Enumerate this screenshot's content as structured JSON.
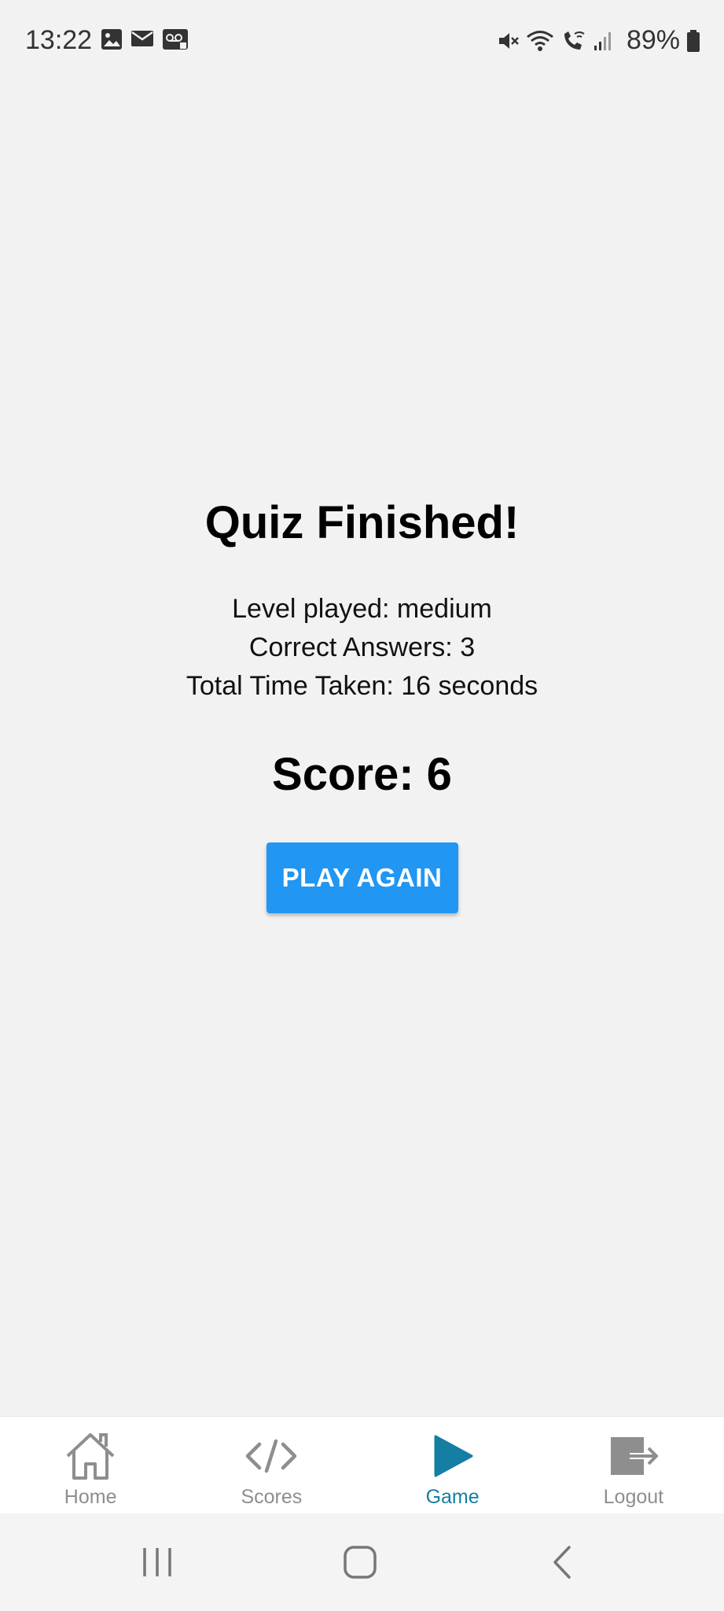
{
  "status_bar": {
    "time": "13:22",
    "battery": "89%",
    "left_icons": [
      "image-icon",
      "mail-icon",
      "voicemail-icon"
    ],
    "right_icons": [
      "mute-icon",
      "wifi-icon",
      "wifi-calling-icon",
      "signal-icon",
      "battery-icon"
    ]
  },
  "quiz": {
    "title": "Quiz Finished!",
    "level_line": "Level played: medium",
    "correct_line": "Correct Answers: 3",
    "time_line": "Total Time Taken: 16 seconds",
    "score_line": "Score: 6",
    "play_again_label": "PLAY AGAIN"
  },
  "tabs": [
    {
      "label": "Home",
      "icon": "home-icon",
      "active": false
    },
    {
      "label": "Scores",
      "icon": "code-icon",
      "active": false
    },
    {
      "label": "Game",
      "icon": "play-icon",
      "active": true
    },
    {
      "label": "Logout",
      "icon": "logout-icon",
      "active": false
    }
  ],
  "colors": {
    "background": "#f2f2f2",
    "button": "#2196f3",
    "active_tab": "#147ea3",
    "inactive_tab": "#8e8e8e"
  },
  "nav_bar": {
    "buttons": [
      "recents-icon",
      "home-nav-icon",
      "back-icon"
    ]
  }
}
